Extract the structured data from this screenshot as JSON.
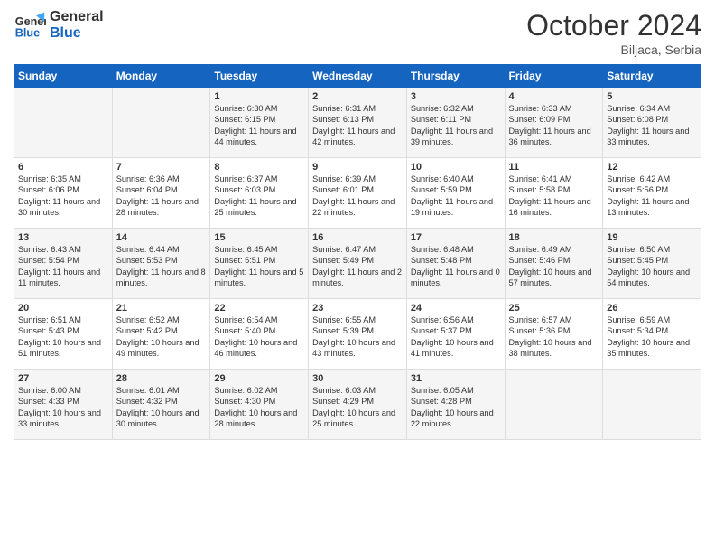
{
  "header": {
    "logo_line1": "General",
    "logo_line2": "Blue",
    "month_year": "October 2024",
    "location": "Biljaca, Serbia"
  },
  "days_of_week": [
    "Sunday",
    "Monday",
    "Tuesday",
    "Wednesday",
    "Thursday",
    "Friday",
    "Saturday"
  ],
  "weeks": [
    [
      {
        "day": "",
        "info": ""
      },
      {
        "day": "",
        "info": ""
      },
      {
        "day": "1",
        "info": "Sunrise: 6:30 AM\nSunset: 6:15 PM\nDaylight: 11 hours and 44 minutes."
      },
      {
        "day": "2",
        "info": "Sunrise: 6:31 AM\nSunset: 6:13 PM\nDaylight: 11 hours and 42 minutes."
      },
      {
        "day": "3",
        "info": "Sunrise: 6:32 AM\nSunset: 6:11 PM\nDaylight: 11 hours and 39 minutes."
      },
      {
        "day": "4",
        "info": "Sunrise: 6:33 AM\nSunset: 6:09 PM\nDaylight: 11 hours and 36 minutes."
      },
      {
        "day": "5",
        "info": "Sunrise: 6:34 AM\nSunset: 6:08 PM\nDaylight: 11 hours and 33 minutes."
      }
    ],
    [
      {
        "day": "6",
        "info": "Sunrise: 6:35 AM\nSunset: 6:06 PM\nDaylight: 11 hours and 30 minutes."
      },
      {
        "day": "7",
        "info": "Sunrise: 6:36 AM\nSunset: 6:04 PM\nDaylight: 11 hours and 28 minutes."
      },
      {
        "day": "8",
        "info": "Sunrise: 6:37 AM\nSunset: 6:03 PM\nDaylight: 11 hours and 25 minutes."
      },
      {
        "day": "9",
        "info": "Sunrise: 6:39 AM\nSunset: 6:01 PM\nDaylight: 11 hours and 22 minutes."
      },
      {
        "day": "10",
        "info": "Sunrise: 6:40 AM\nSunset: 5:59 PM\nDaylight: 11 hours and 19 minutes."
      },
      {
        "day": "11",
        "info": "Sunrise: 6:41 AM\nSunset: 5:58 PM\nDaylight: 11 hours and 16 minutes."
      },
      {
        "day": "12",
        "info": "Sunrise: 6:42 AM\nSunset: 5:56 PM\nDaylight: 11 hours and 13 minutes."
      }
    ],
    [
      {
        "day": "13",
        "info": "Sunrise: 6:43 AM\nSunset: 5:54 PM\nDaylight: 11 hours and 11 minutes."
      },
      {
        "day": "14",
        "info": "Sunrise: 6:44 AM\nSunset: 5:53 PM\nDaylight: 11 hours and 8 minutes."
      },
      {
        "day": "15",
        "info": "Sunrise: 6:45 AM\nSunset: 5:51 PM\nDaylight: 11 hours and 5 minutes."
      },
      {
        "day": "16",
        "info": "Sunrise: 6:47 AM\nSunset: 5:49 PM\nDaylight: 11 hours and 2 minutes."
      },
      {
        "day": "17",
        "info": "Sunrise: 6:48 AM\nSunset: 5:48 PM\nDaylight: 11 hours and 0 minutes."
      },
      {
        "day": "18",
        "info": "Sunrise: 6:49 AM\nSunset: 5:46 PM\nDaylight: 10 hours and 57 minutes."
      },
      {
        "day": "19",
        "info": "Sunrise: 6:50 AM\nSunset: 5:45 PM\nDaylight: 10 hours and 54 minutes."
      }
    ],
    [
      {
        "day": "20",
        "info": "Sunrise: 6:51 AM\nSunset: 5:43 PM\nDaylight: 10 hours and 51 minutes."
      },
      {
        "day": "21",
        "info": "Sunrise: 6:52 AM\nSunset: 5:42 PM\nDaylight: 10 hours and 49 minutes."
      },
      {
        "day": "22",
        "info": "Sunrise: 6:54 AM\nSunset: 5:40 PM\nDaylight: 10 hours and 46 minutes."
      },
      {
        "day": "23",
        "info": "Sunrise: 6:55 AM\nSunset: 5:39 PM\nDaylight: 10 hours and 43 minutes."
      },
      {
        "day": "24",
        "info": "Sunrise: 6:56 AM\nSunset: 5:37 PM\nDaylight: 10 hours and 41 minutes."
      },
      {
        "day": "25",
        "info": "Sunrise: 6:57 AM\nSunset: 5:36 PM\nDaylight: 10 hours and 38 minutes."
      },
      {
        "day": "26",
        "info": "Sunrise: 6:59 AM\nSunset: 5:34 PM\nDaylight: 10 hours and 35 minutes."
      }
    ],
    [
      {
        "day": "27",
        "info": "Sunrise: 6:00 AM\nSunset: 4:33 PM\nDaylight: 10 hours and 33 minutes."
      },
      {
        "day": "28",
        "info": "Sunrise: 6:01 AM\nSunset: 4:32 PM\nDaylight: 10 hours and 30 minutes."
      },
      {
        "day": "29",
        "info": "Sunrise: 6:02 AM\nSunset: 4:30 PM\nDaylight: 10 hours and 28 minutes."
      },
      {
        "day": "30",
        "info": "Sunrise: 6:03 AM\nSunset: 4:29 PM\nDaylight: 10 hours and 25 minutes."
      },
      {
        "day": "31",
        "info": "Sunrise: 6:05 AM\nSunset: 4:28 PM\nDaylight: 10 hours and 22 minutes."
      },
      {
        "day": "",
        "info": ""
      },
      {
        "day": "",
        "info": ""
      }
    ]
  ]
}
